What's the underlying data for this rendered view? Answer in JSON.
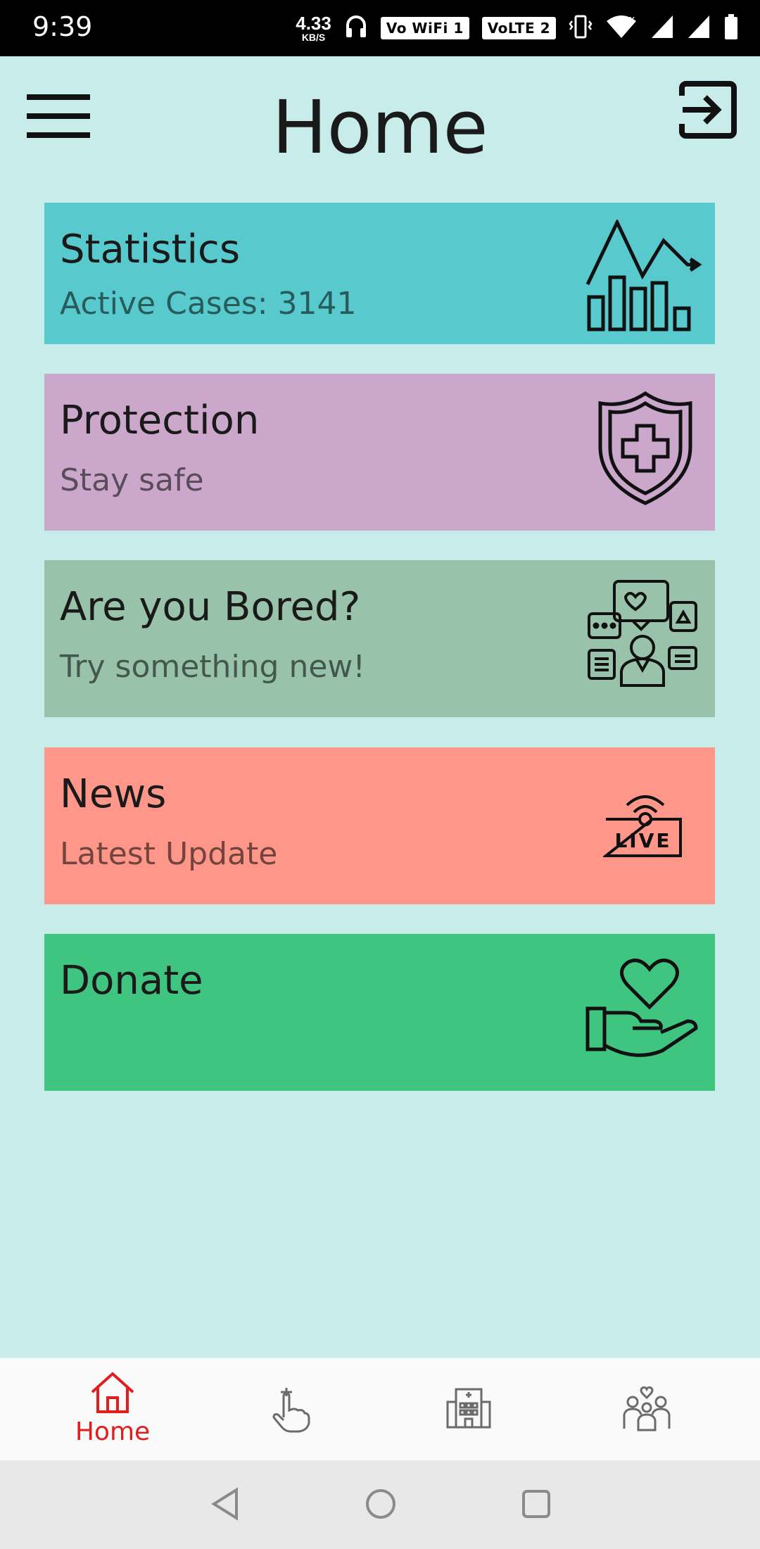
{
  "status_bar": {
    "time": "9:39",
    "speed_value": "4.33",
    "speed_unit": "KB/S",
    "wifi_chip": "Vo WiFi 1",
    "volte_chip": "VoLTE 2",
    "icons": [
      "headphones-icon",
      "vibrate-icon",
      "wifi-icon",
      "signal-icon",
      "signal-icon",
      "battery-icon"
    ]
  },
  "header": {
    "title": "Home",
    "menu_icon": "hamburger-menu-icon",
    "logout_icon": "logout-icon"
  },
  "cards": [
    {
      "title": "Statistics",
      "subtitle": "Active Cases: 3141",
      "icon": "statistics-chart-icon",
      "color": "#58cacd"
    },
    {
      "title": "Protection",
      "subtitle": "Stay safe",
      "icon": "shield-cross-icon",
      "color": "#cba8cb"
    },
    {
      "title": "Are you Bored?",
      "subtitle": "Try something new!",
      "icon": "chat-person-icon",
      "color": "#98c2aa"
    },
    {
      "title": "News",
      "subtitle": "Latest Update",
      "icon": "live-broadcast-icon",
      "color": "#fe9789"
    },
    {
      "title": "Donate",
      "subtitle": "",
      "icon": "heart-hand-icon",
      "color": "#40c580"
    }
  ],
  "bottom_nav": {
    "items": [
      {
        "label": "Home",
        "icon": "home-icon",
        "active": true
      },
      {
        "label": "",
        "icon": "hand-touch-icon",
        "active": false
      },
      {
        "label": "",
        "icon": "hospital-icon",
        "active": false
      },
      {
        "label": "",
        "icon": "family-icon",
        "active": false
      }
    ],
    "active_color": "#e01e1e"
  },
  "system_nav": {
    "icons": [
      "back-icon",
      "home-circle-icon",
      "recents-icon"
    ]
  }
}
